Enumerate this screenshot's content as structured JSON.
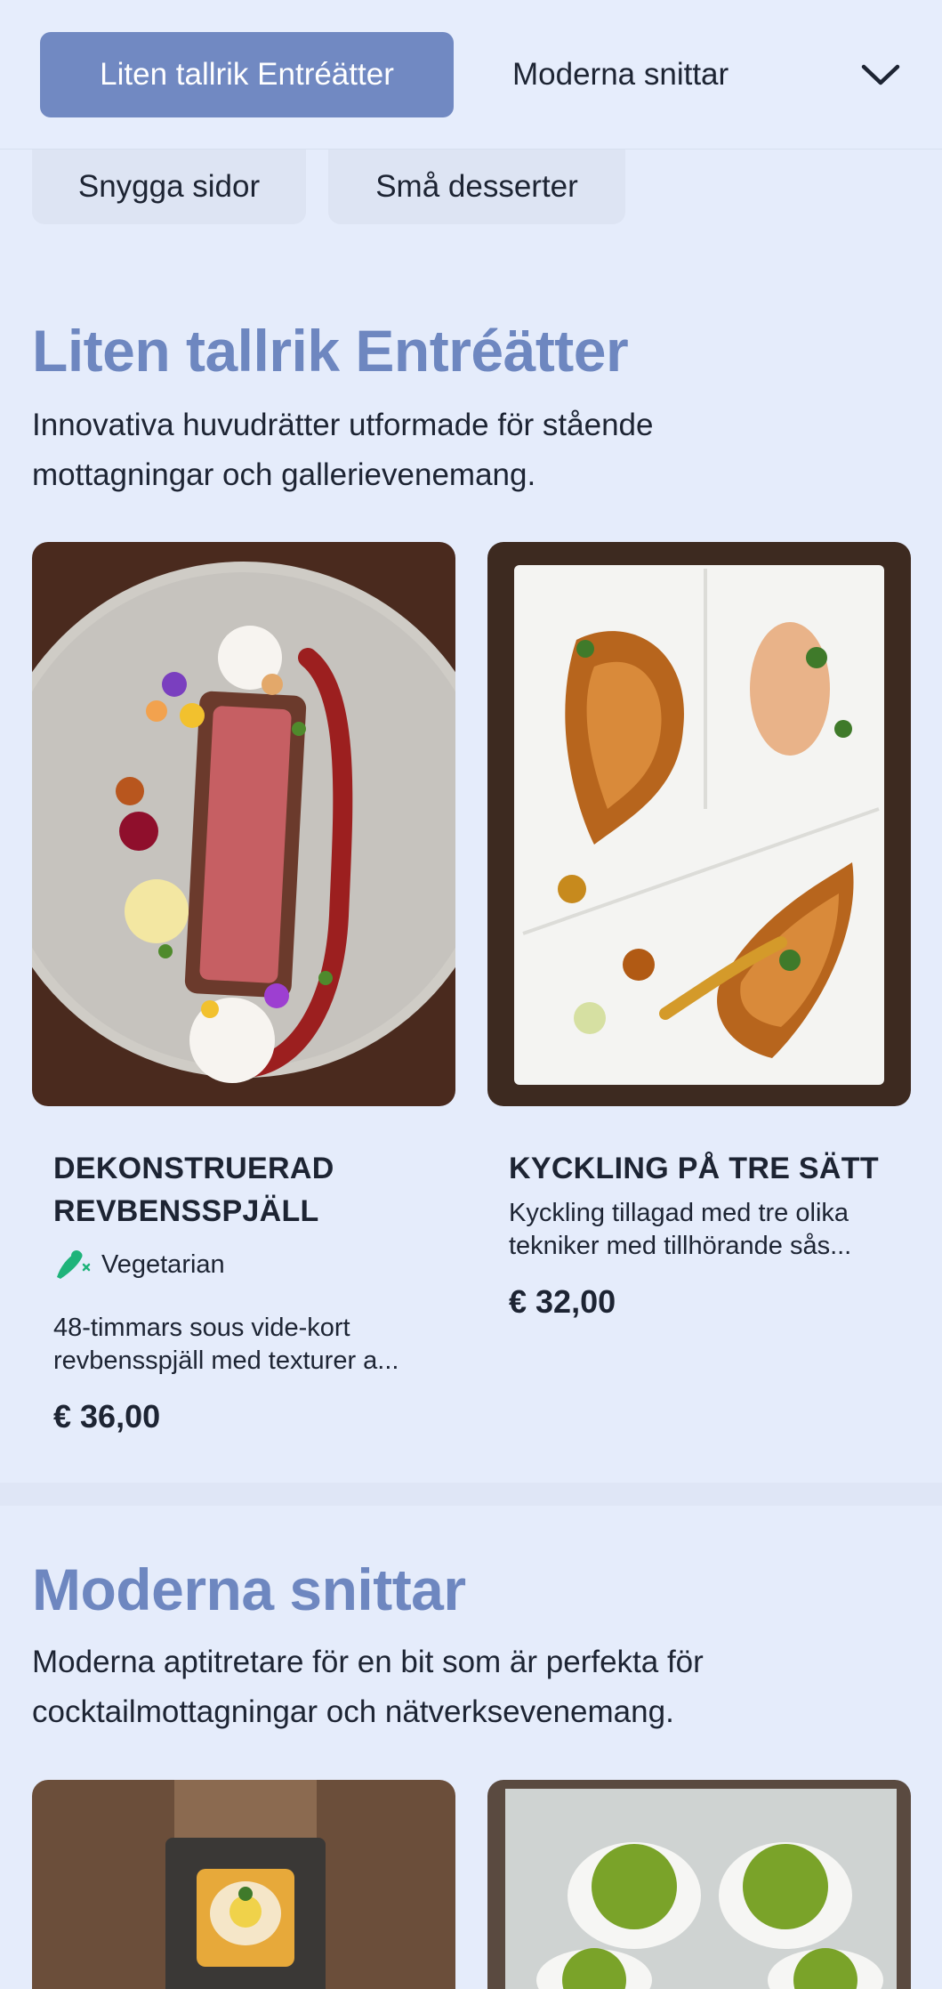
{
  "nav": {
    "active_category": "Liten tallrik Entréätter",
    "next_category": "Moderna snittar",
    "more_categories": [
      "Snygga sidor",
      "Små desserter"
    ]
  },
  "sections": [
    {
      "title": "Liten tallrik Entréätter",
      "description": "Innovativa huvudrätter utformade för stående mottagningar och gallerievenemang.",
      "items": [
        {
          "name_line1": "DEKONSTRUERAD",
          "name_line2": "REVBENSSPJÄLL",
          "tag": "Vegetarian",
          "desc_line1": "48-timmars sous vide-kort",
          "desc_line2": "revbensspjäll med texturer a...",
          "price": "€ 36,00",
          "image_icon": "plated-ribs-image"
        },
        {
          "name_line1": "KYCKLING PÅ TRE SÄTT",
          "desc_line1": "Kyckling tillagad med tre olika",
          "desc_line2": "tekniker med tillhörande sås...",
          "price": "€ 32,00",
          "image_icon": "chicken-trio-image"
        }
      ]
    },
    {
      "title": "Moderna snittar",
      "description_line1": "Moderna aptitretare för en bit som är perfekta för",
      "description_line2": "cocktailmottagningar och nätverksevenemang."
    }
  ],
  "colors": {
    "background": "#e5ecfb",
    "accent": "#7189c2",
    "title": "#6e87c0",
    "vegetarian_icon": "#1fb37a"
  }
}
